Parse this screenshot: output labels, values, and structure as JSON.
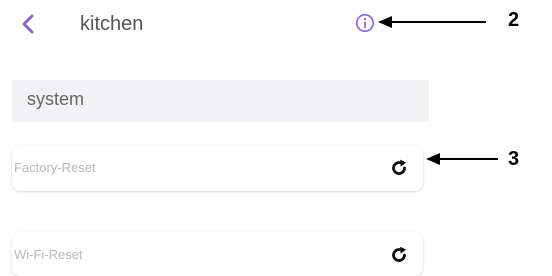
{
  "header": {
    "back_icon": "chevron-left-icon",
    "title": "kitchen",
    "info_icon": "info-circle-icon",
    "accent_color": "#8a63d2"
  },
  "section": {
    "label": "system"
  },
  "rows": [
    {
      "label": "Factory-Reset",
      "icon": "refresh-icon"
    },
    {
      "label": "Wi-Fi-Reset",
      "icon": "refresh-icon"
    }
  ],
  "annotations": [
    {
      "number": "2"
    },
    {
      "number": "3"
    }
  ]
}
